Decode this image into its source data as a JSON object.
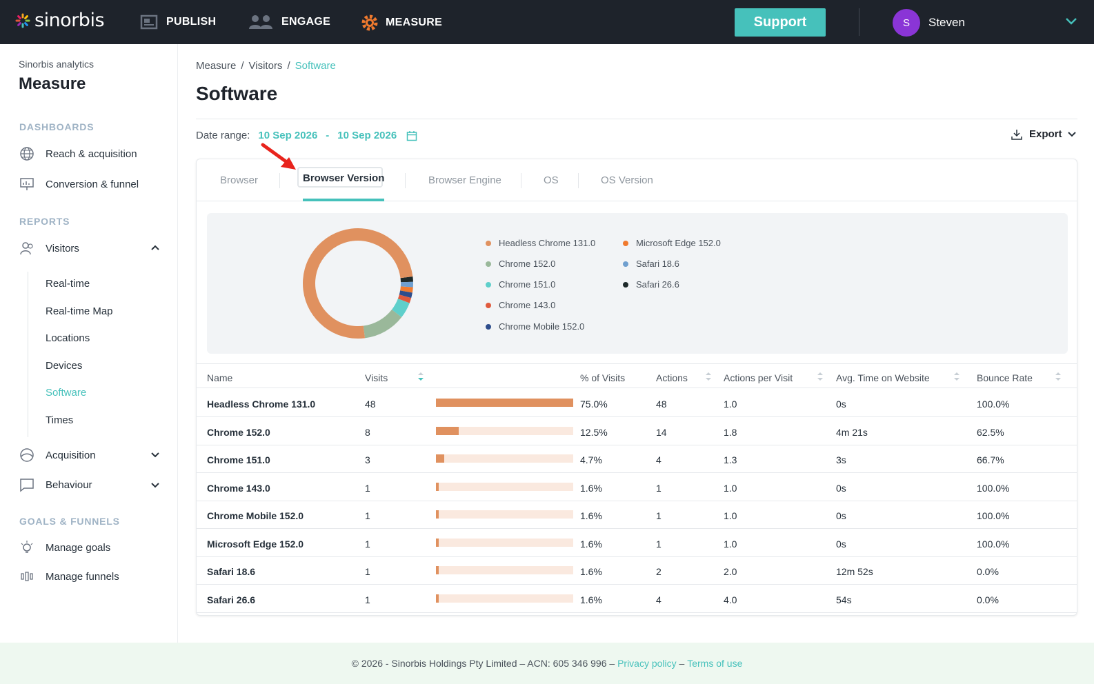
{
  "app": {
    "logo_text": "sinorbis",
    "nav": [
      {
        "label": "PUBLISH",
        "icon": "publish-icon"
      },
      {
        "label": "ENGAGE",
        "icon": "people-icon"
      },
      {
        "label": "MEASURE",
        "icon": "gear-icon"
      }
    ],
    "support_label": "Support",
    "user": {
      "initial": "S",
      "name": "Steven"
    },
    "accent": "#46c1bb"
  },
  "sidebar": {
    "subtitle": "Sinorbis analytics",
    "title": "Measure",
    "sections": {
      "dashboards": "DASHBOARDS",
      "reports": "REPORTS",
      "goals": "GOALS & FUNNELS"
    },
    "dashboard_items": [
      "Reach & acquisition",
      "Conversion & funnel"
    ],
    "visitors_label": "Visitors",
    "visitor_subitems": [
      "Real-time",
      "Real-time Map",
      "Locations",
      "Devices",
      "Software",
      "Times"
    ],
    "active_subitem": "Software",
    "acquisition_label": "Acquisition",
    "behaviour_label": "Behaviour",
    "goal_items": [
      "Manage goals",
      "Manage funnels"
    ]
  },
  "main": {
    "breadcrumb": [
      "Measure",
      "Visitors",
      "Software"
    ],
    "title": "Software",
    "date_label": "Date range:",
    "date_from": "10 Sep 2026",
    "date_sep": "-",
    "date_to": "10 Sep 2026",
    "export_label": "Export",
    "tabs": [
      "Browser",
      "Browser Version",
      "Browser Engine",
      "OS",
      "OS Version"
    ],
    "active_tab": "Browser Version"
  },
  "chart_data": {
    "type": "pie",
    "donut": true,
    "categories": [
      "Headless Chrome 131.0",
      "Chrome 152.0",
      "Chrome 151.0",
      "Chrome 143.0",
      "Chrome Mobile 152.0",
      "Microsoft Edge 152.0",
      "Safari 18.6",
      "Safari 26.6"
    ],
    "values": [
      48,
      8,
      3,
      1,
      1,
      1,
      1,
      1
    ],
    "colors": [
      "#e0915f",
      "#9ab89a",
      "#5fcfcb",
      "#e05a3d",
      "#2e4d8c",
      "#f07a2e",
      "#6f9fcf",
      "#1e2a2a"
    ],
    "legend_position": "right"
  },
  "table": {
    "headers": {
      "name": "Name",
      "visits": "Visits",
      "pct": "% of Visits",
      "actions": "Actions",
      "apv": "Actions per Visit",
      "avg_time": "Avg. Time on Website",
      "bounce": "Bounce Rate"
    },
    "rows": [
      {
        "name": "Headless Chrome 131.0",
        "visits": "48",
        "share": 0.75,
        "pct": "75.0%",
        "actions": "48",
        "apv": "1.0",
        "avg_time": "0s",
        "bounce": "100.0%"
      },
      {
        "name": "Chrome 152.0",
        "visits": "8",
        "share": 0.125,
        "pct": "12.5%",
        "actions": "14",
        "apv": "1.8",
        "avg_time": "4m 21s",
        "bounce": "62.5%"
      },
      {
        "name": "Chrome 151.0",
        "visits": "3",
        "share": 0.047,
        "pct": "4.7%",
        "actions": "4",
        "apv": "1.3",
        "avg_time": "3s",
        "bounce": "66.7%"
      },
      {
        "name": "Chrome 143.0",
        "visits": "1",
        "share": 0.016,
        "pct": "1.6%",
        "actions": "1",
        "apv": "1.0",
        "avg_time": "0s",
        "bounce": "100.0%"
      },
      {
        "name": "Chrome Mobile 152.0",
        "visits": "1",
        "share": 0.016,
        "pct": "1.6%",
        "actions": "1",
        "apv": "1.0",
        "avg_time": "0s",
        "bounce": "100.0%"
      },
      {
        "name": "Microsoft Edge 152.0",
        "visits": "1",
        "share": 0.016,
        "pct": "1.6%",
        "actions": "1",
        "apv": "1.0",
        "avg_time": "0s",
        "bounce": "100.0%"
      },
      {
        "name": "Safari 18.6",
        "visits": "1",
        "share": 0.016,
        "pct": "1.6%",
        "actions": "2",
        "apv": "2.0",
        "avg_time": "12m 52s",
        "bounce": "0.0%"
      },
      {
        "name": "Safari 26.6",
        "visits": "1",
        "share": 0.016,
        "pct": "1.6%",
        "actions": "4",
        "apv": "4.0",
        "avg_time": "54s",
        "bounce": "0.0%"
      }
    ]
  },
  "footer": {
    "text": "© 2026 - Sinorbis Holdings Pty Limited – ACN: 605 346 996 –",
    "privacy": "Privacy policy",
    "dash": "–",
    "terms": "Terms of use"
  }
}
